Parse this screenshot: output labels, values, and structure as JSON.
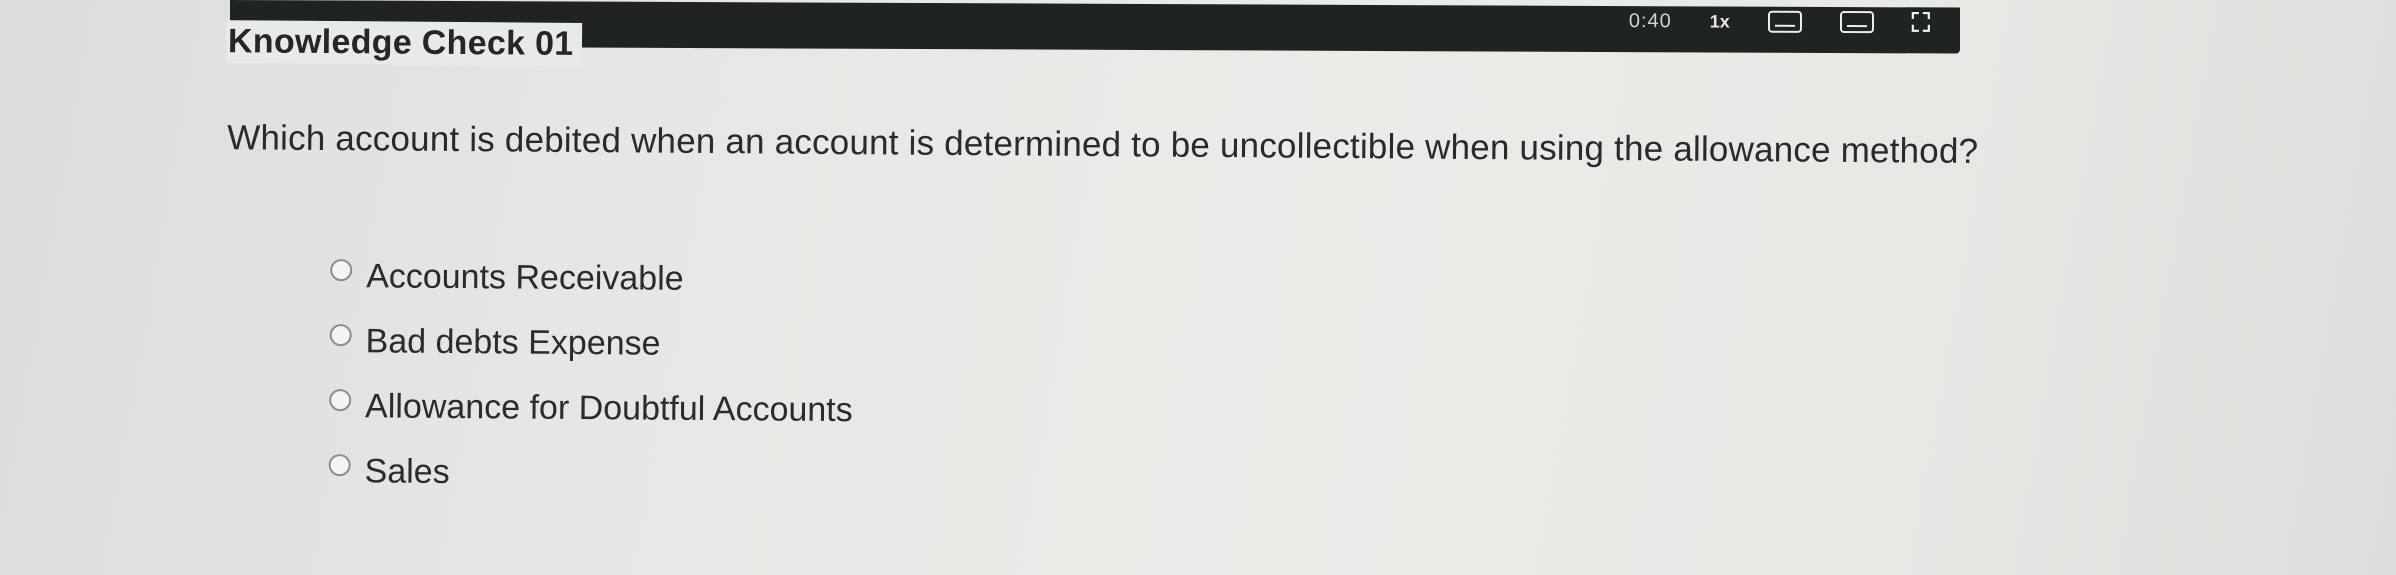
{
  "player": {
    "time": "0:40",
    "speed": "1x",
    "icons": [
      "closed-captions-icon",
      "transcript-icon",
      "fullscreen-icon"
    ]
  },
  "quiz": {
    "title": "Knowledge Check 01",
    "question": "Which account is debited when an account is determined to be uncollectible when using the allowance method?",
    "options": [
      "Accounts Receivable",
      "Bad debts Expense",
      "Allowance for Doubtful Accounts",
      "Sales"
    ]
  }
}
